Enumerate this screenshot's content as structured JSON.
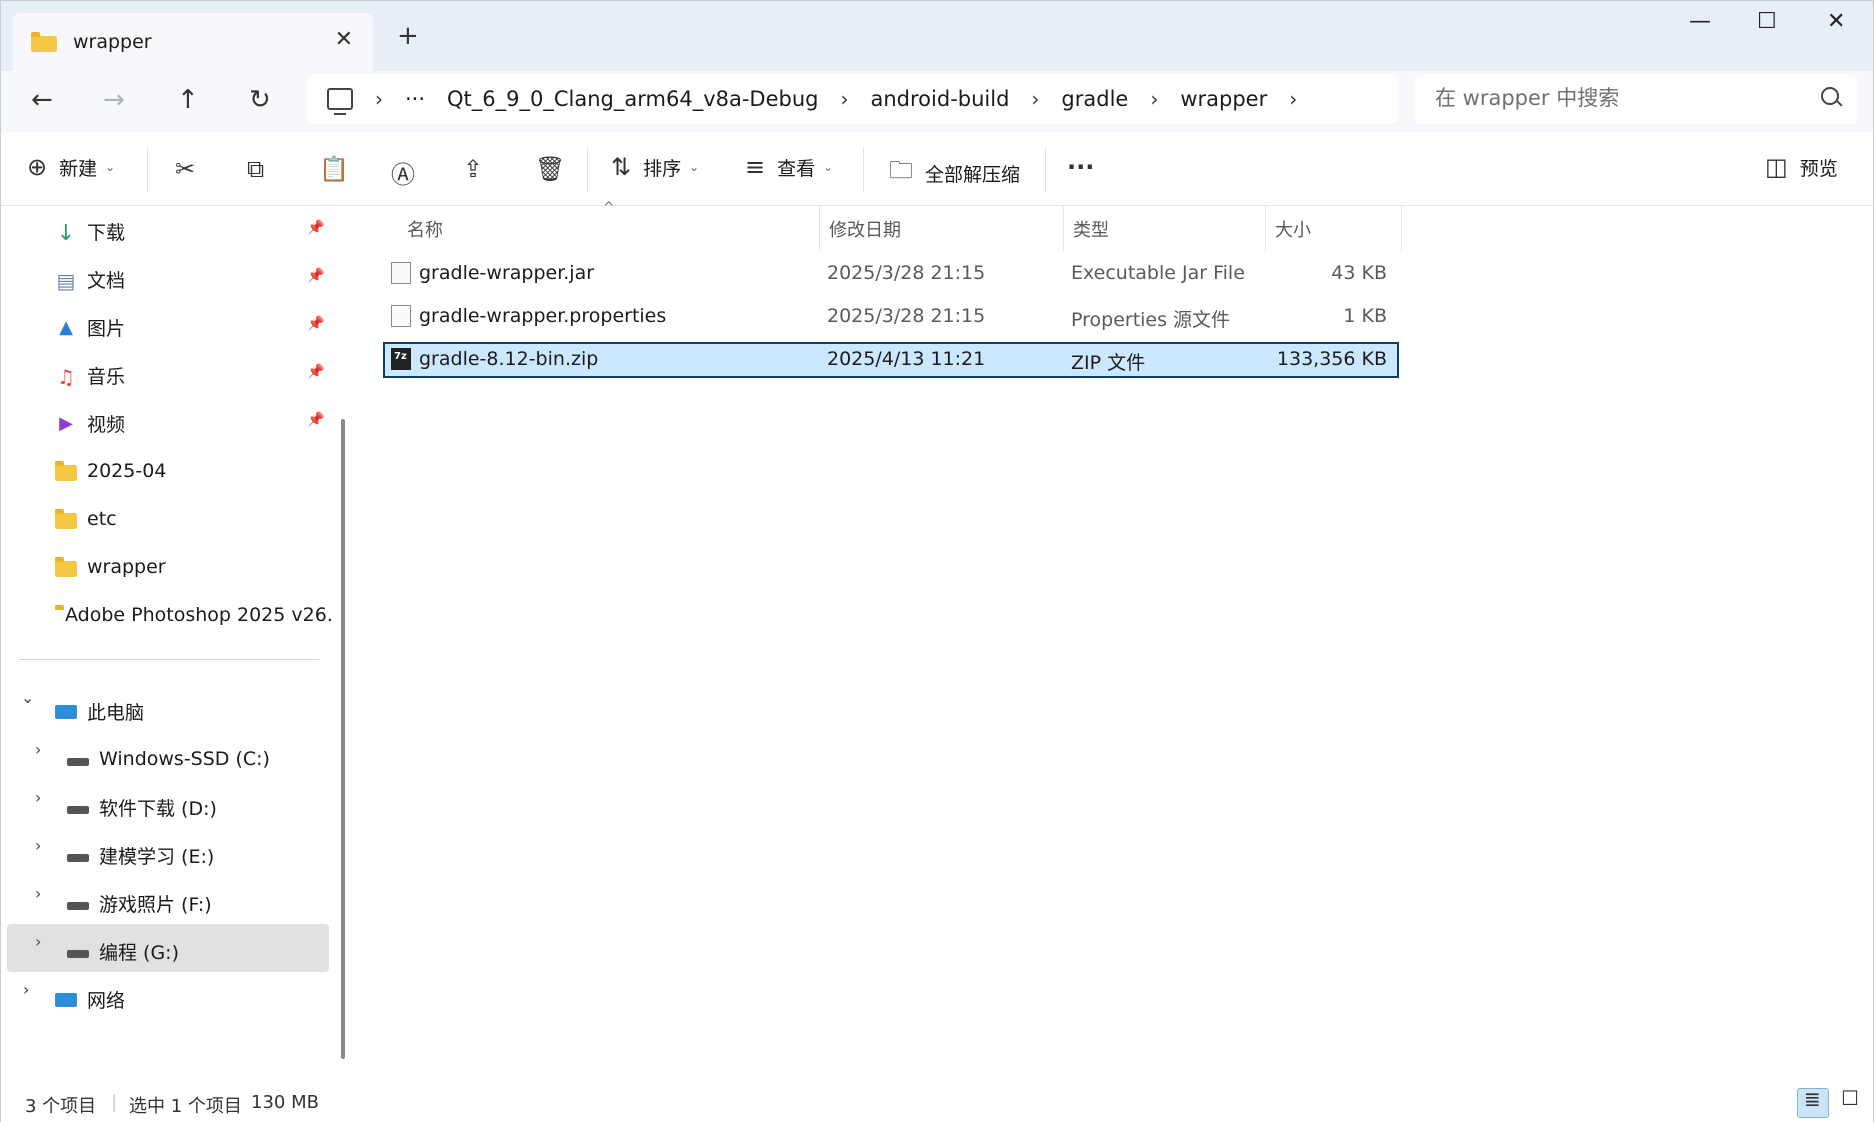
{
  "window": {
    "tab_title": "wrapper",
    "close_tab": "✕",
    "new_tab": "+",
    "minimize": "—",
    "maximize": "☐",
    "close": "✕"
  },
  "nav": {
    "back": "←",
    "forward": "→",
    "up": "↑",
    "refresh": "↻",
    "more": "···",
    "breadcrumbs": [
      "Qt_6_9_0_Clang_arm64_v8a-Debug",
      "android-build",
      "gradle",
      "wrapper"
    ],
    "chevron": "›",
    "search_placeholder": "在 wrapper 中搜索"
  },
  "toolbar": {
    "new_label": "新建",
    "sort_label": "排序",
    "view_label": "查看",
    "extract_label": "全部解压缩",
    "more": "···",
    "preview_label": "预览",
    "icons": {
      "new": "⊕",
      "cut": "✂",
      "copy": "⧉",
      "paste": "📋",
      "rename": "Ⓐ",
      "share": "⇪",
      "delete": "🗑",
      "sort": "⇅",
      "view": "≡",
      "extract": "🗀",
      "preview": "◫"
    }
  },
  "sidebar": {
    "quick": [
      {
        "label": "下载",
        "icon": "↓",
        "color": "#2a9d5a"
      },
      {
        "label": "文档",
        "icon": "▤",
        "color": "#6b7fa6"
      },
      {
        "label": "图片",
        "icon": "▲",
        "color": "#2b7fd8"
      },
      {
        "label": "音乐",
        "icon": "♫",
        "color": "#e0533d"
      },
      {
        "label": "视频",
        "icon": "▶",
        "color": "#8a3fd1"
      }
    ],
    "pin": "📌",
    "folders": [
      "2025-04",
      "etc",
      "wrapper",
      "Adobe Photoshop 2025 v26."
    ],
    "this_pc": "此电脑",
    "drives": [
      "Windows-SSD (C:)",
      "软件下载 (D:)",
      "建模学习 (E:)",
      "游戏照片 (F:)",
      "编程 (G:)"
    ],
    "network": "网络",
    "expand": "›",
    "collapse": "⌄"
  },
  "columns": {
    "name": "名称",
    "date": "修改日期",
    "type": "类型",
    "size": "大小",
    "sort_arrow": "^"
  },
  "files": [
    {
      "name": "gradle-wrapper.jar",
      "date": "2025/3/28 21:15",
      "type": "Executable Jar File",
      "size": "43 KB"
    },
    {
      "name": "gradle-wrapper.properties",
      "date": "2025/3/28 21:15",
      "type": "Properties 源文件",
      "size": "1 KB"
    },
    {
      "name": "gradle-8.12-bin.zip",
      "date": "2025/4/13 11:21",
      "type": "ZIP 文件",
      "size": "133,356 KB"
    }
  ],
  "status": {
    "count": "3 个项目",
    "selected": "选中 1 个项目",
    "selected_size": "130 MB"
  },
  "colors": {
    "selection": "#cce8ff",
    "selection_border": "#0b3e66",
    "folder": "#f6c744"
  }
}
